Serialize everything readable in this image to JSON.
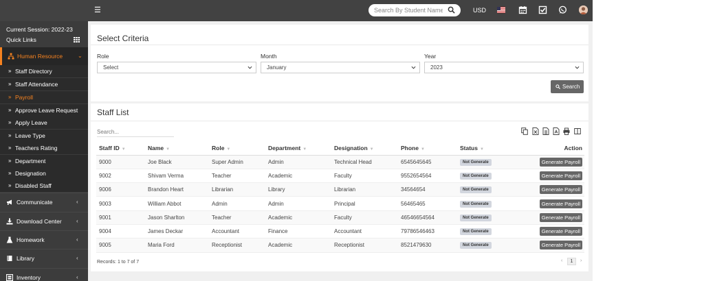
{
  "topbar": {
    "search_placeholder": "Search By Student Name",
    "currency": "USD"
  },
  "sidebar": {
    "session": "Current Session: 2022-23",
    "quick_links": "Quick Links",
    "active_menu": "Human Resource",
    "submenu": [
      "Staff Directory",
      "Staff Attendance",
      "Payroll",
      "Approve Leave Request",
      "Apply Leave",
      "Leave Type",
      "Teachers Rating",
      "Department",
      "Designation",
      "Disabled Staff"
    ],
    "menus": [
      "Communicate",
      "Download Center",
      "Homework",
      "Library",
      "Inventory"
    ]
  },
  "criteria": {
    "title": "Select Criteria",
    "role_label": "Role",
    "role_value": "Select",
    "month_label": "Month",
    "month_value": "January",
    "year_label": "Year",
    "year_value": "2023",
    "search_button": "Search"
  },
  "staff": {
    "title": "Staff List",
    "search_placeholder": "Search...",
    "columns": [
      "Staff ID",
      "Name",
      "Role",
      "Department",
      "Designation",
      "Phone",
      "Status",
      "Action"
    ],
    "rows": [
      [
        "9000",
        "Joe Black",
        "Super Admin",
        "Admin",
        "Technical Head",
        "6545645645",
        "Not Generate",
        "Generate Payroll"
      ],
      [
        "9002",
        "Shivam Verma",
        "Teacher",
        "Academic",
        "Faculty",
        "9552654564",
        "Not Generate",
        "Generate Payroll"
      ],
      [
        "9006",
        "Brandon Heart",
        "Librarian",
        "Library",
        "Librarian",
        "34564654",
        "Not Generate",
        "Generate Payroll"
      ],
      [
        "9003",
        "William Abbot",
        "Admin",
        "Admin",
        "Principal",
        "56465465",
        "Not Generate",
        "Generate Payroll"
      ],
      [
        "9001",
        "Jason Sharlton",
        "Teacher",
        "Academic",
        "Faculty",
        "46546654564",
        "Not Generate",
        "Generate Payroll"
      ],
      [
        "9004",
        "James Deckar",
        "Accountant",
        "Finance",
        "Accountant",
        "79786546463",
        "Not Generate",
        "Generate Payroll"
      ],
      [
        "9005",
        "Maria Ford",
        "Receptionist",
        "Academic",
        "Receptionist",
        "8521479630",
        "Not Generate",
        "Generate Payroll"
      ]
    ],
    "records": "Records: 1 to 7 of 7",
    "page": "1"
  },
  "colors": {
    "accent": "#f58220",
    "topbar": "#424242",
    "sidebar": "#3c3c3c"
  }
}
